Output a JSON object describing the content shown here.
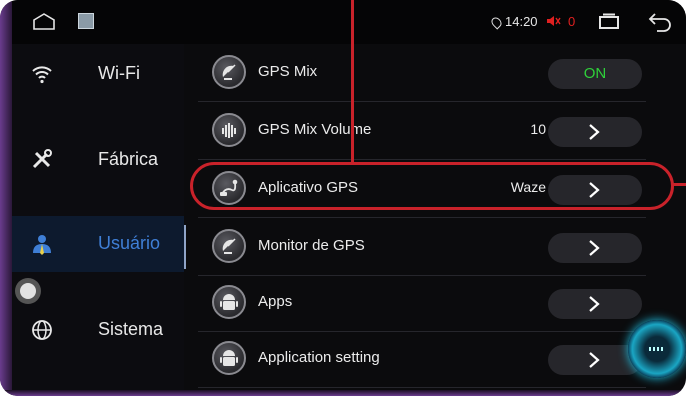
{
  "status_bar": {
    "time": "14:20",
    "volume": "0",
    "icons": [
      "home-icon",
      "thumbnail-icon",
      "location-pin-icon",
      "volume-muted-icon",
      "recent-apps-icon",
      "back-icon"
    ]
  },
  "sidebar": {
    "items": [
      {
        "label": "Wi-Fi",
        "icon": "wifi-icon",
        "active": false
      },
      {
        "label": "Fábrica",
        "icon": "tools-icon",
        "active": false
      },
      {
        "label": "Usuário",
        "icon": "user-icon",
        "active": true
      },
      {
        "label": "Sistema",
        "icon": "globe-icon",
        "active": false
      }
    ]
  },
  "settings": {
    "rows": [
      {
        "label": "GPS Mix",
        "value": "",
        "control": "toggle",
        "control_text": "ON",
        "icon": "satellite-dish-icon"
      },
      {
        "label": "GPS Mix Volume",
        "value": "10",
        "control": "chevron",
        "icon": "volume-bars-icon"
      },
      {
        "label": "Aplicativo GPS",
        "value": "Waze",
        "control": "chevron",
        "icon": "gps-route-icon"
      },
      {
        "label": "Monitor de GPS",
        "value": "",
        "control": "chevron",
        "icon": "satellite-dish-icon"
      },
      {
        "label": "Apps",
        "value": "",
        "control": "chevron",
        "icon": "android-icon"
      },
      {
        "label": "Application setting",
        "value": "",
        "control": "chevron",
        "icon": "android-icon"
      }
    ]
  },
  "colors": {
    "background": "#0b0b0d",
    "active_accent": "#3f7fd6",
    "toggle_on": "#2fd13a",
    "annotation_red": "#c9222a",
    "device_rim": "#6a3c8e"
  }
}
